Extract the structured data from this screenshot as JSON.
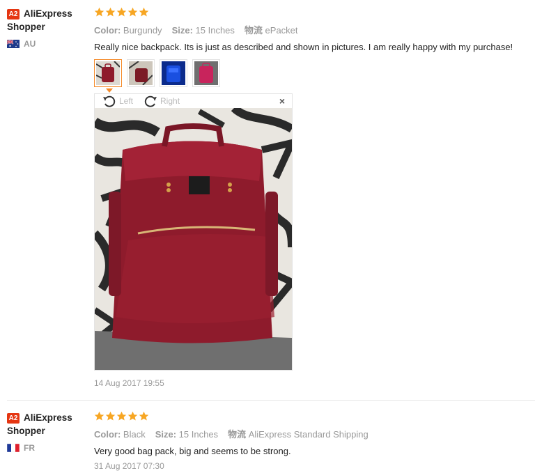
{
  "reviews": [
    {
      "badge": "A2",
      "name_line1": "AliExpress",
      "name_line2": "Shopper",
      "country": "AU",
      "rating": 5,
      "color_label": "Color:",
      "color_value": "Burgundy",
      "size_label": "Size:",
      "size_value": "15 Inches",
      "shipping_label": "物流",
      "shipping_value": "ePacket",
      "text": "Really nice backpack. Its is just as described and shown in pictures. I am really happy with my purchase!",
      "thumbnails": [
        "burgundy-backpack-photo",
        "backpack-on-bed-photo",
        "blue-backpack-photo",
        "pink-backpack-photo"
      ],
      "viewer": {
        "rotate_left": "Left",
        "rotate_right": "Right",
        "close": "×"
      },
      "date": "14 Aug 2017 19:55"
    },
    {
      "badge": "A2",
      "name_line1": "AliExpress",
      "name_line2": "Shopper",
      "country": "FR",
      "rating": 5,
      "color_label": "Color:",
      "color_value": "Black",
      "size_label": "Size:",
      "size_value": "15 Inches",
      "shipping_label": "物流",
      "shipping_value": "AliExpress Standard Shipping",
      "text": "Very good bag pack, big and seems to be strong.",
      "date": "31 Aug 2017 07:30"
    }
  ],
  "colors": {
    "badge": "#e53612",
    "star": "#f7a623",
    "selected_thumb": "#f58b2a",
    "backpack": "#8e1b2c"
  }
}
